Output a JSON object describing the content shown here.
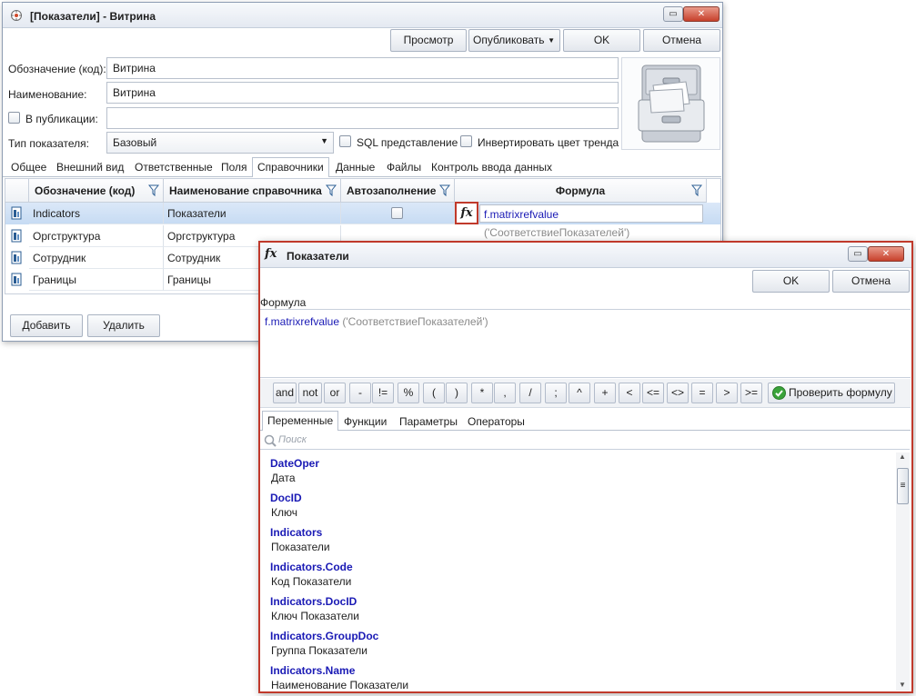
{
  "main_window": {
    "title": "[Показатели] - Витрина",
    "toolbar": {
      "preview": "Просмотр",
      "publish": "Опубликовать",
      "ok": "OK",
      "cancel": "Отмена"
    },
    "form": {
      "code_label": "Обозначение (код):",
      "code_value": "Витрина",
      "name_label": "Наименование:",
      "name_value": "Витрина",
      "in_publication_label": "В публикации:",
      "in_publication_value": "",
      "type_label": "Тип показателя:",
      "type_value": "Базовый",
      "sql_label": "SQL представление",
      "invert_label": "Инвертировать цвет тренда"
    },
    "tabs": [
      "Общее",
      "Внешний вид",
      "Ответственные",
      "Поля",
      "Справочники",
      "Данные",
      "Файлы",
      "Контроль ввода данных"
    ],
    "active_tab": "Справочники",
    "grid": {
      "columns": [
        "Обозначение (код)",
        "Наименование справочника",
        "Автозаполнение",
        "Формула"
      ],
      "rows": [
        {
          "code": "Indicators",
          "name": "Показатели",
          "formula_fn": "f.matrixrefvalue",
          "formula_arg": "('СоответствиеПоказателей')"
        },
        {
          "code": "Оргструктура",
          "name": "Оргструктура"
        },
        {
          "code": "Сотрудник",
          "name": "Сотрудник"
        },
        {
          "code": "Границы",
          "name": "Границы"
        }
      ]
    },
    "footer": {
      "add": "Добавить",
      "delete": "Удалить"
    }
  },
  "formula_dialog": {
    "title": "Показатели",
    "fx_glyph": "fx",
    "ok": "OK",
    "cancel": "Отмена",
    "formula_label": "Формула",
    "formula_fn": "f.matrixrefvalue",
    "formula_arg": "('СоответствиеПоказателей')",
    "operators": [
      "and",
      "not",
      "or",
      "-",
      "!=",
      "%",
      "(",
      ")",
      "*",
      ",",
      "/",
      ";",
      "^",
      "+",
      "<",
      "<=",
      "<>",
      "=",
      ">",
      ">="
    ],
    "check_button": "Проверить формулу",
    "tabs": [
      "Переменные",
      "Функции",
      "Параметры",
      "Операторы"
    ],
    "active_tab": "Переменные",
    "search_placeholder": "Поиск",
    "variables": [
      {
        "name": "DateOper",
        "desc": "Дата"
      },
      {
        "name": "DocID",
        "desc": "Ключ"
      },
      {
        "name": "Indicators",
        "desc": "Показатели"
      },
      {
        "name": "Indicators.Code",
        "desc": "Код Показатели"
      },
      {
        "name": "Indicators.DocID",
        "desc": "Ключ Показатели"
      },
      {
        "name": "Indicators.GroupDoc",
        "desc": "Группа Показатели"
      },
      {
        "name": "Indicators.Name",
        "desc": "Наименование Показатели"
      }
    ]
  },
  "colors": {
    "accent_border": "#c0392b",
    "var_name": "#1a1ab5",
    "selection": "#c6dbf3"
  },
  "icons": [
    "app-icon",
    "restore-icon",
    "close-icon",
    "dropdown-arrow-icon",
    "filter-icon",
    "row-document-icon",
    "fx-icon",
    "check-icon",
    "search-icon",
    "filing-cabinet-icon",
    "scroll-up-icon",
    "scroll-down-icon"
  ]
}
